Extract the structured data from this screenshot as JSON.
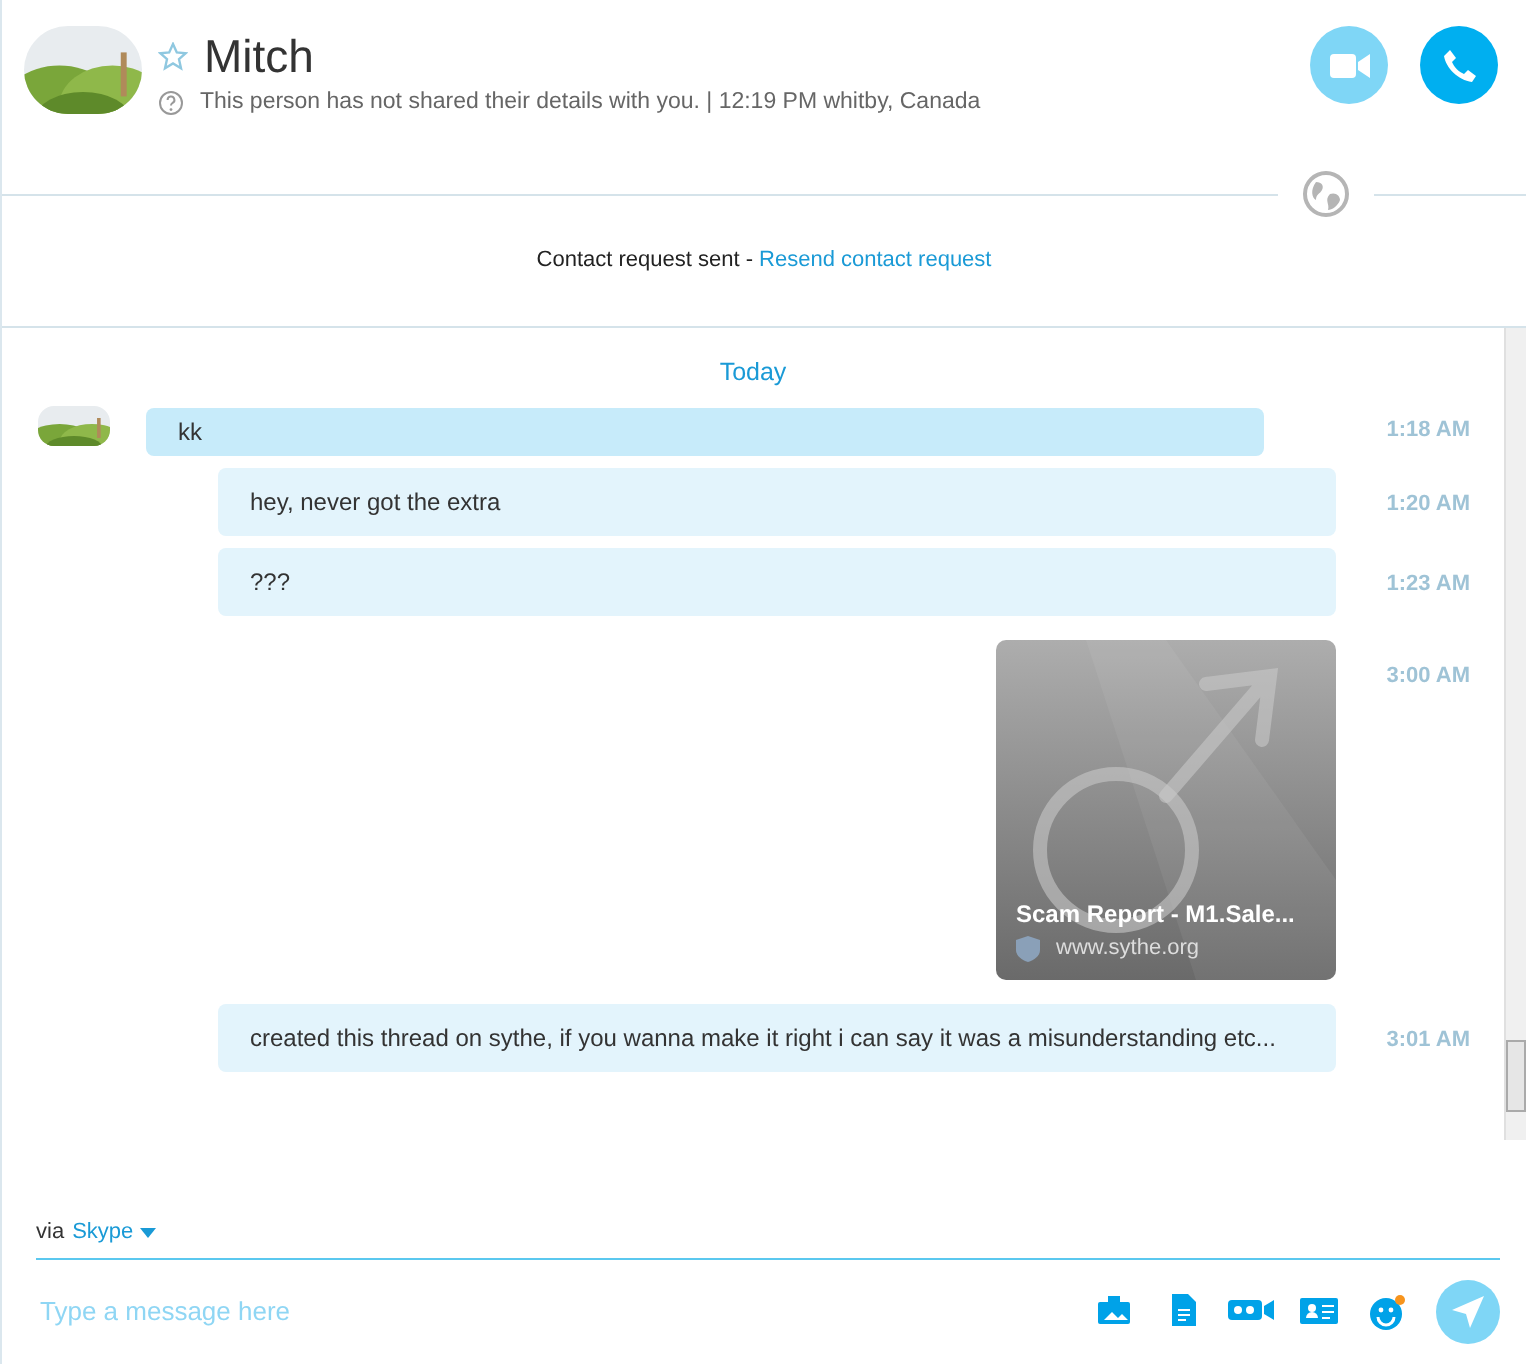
{
  "contact": {
    "name": "Mitch",
    "favorite": false,
    "status": "This person has not shared their details with you. | 12:19 PM whitby, Canada"
  },
  "contact_request": {
    "text": "Contact request sent -",
    "link": "Resend contact request"
  },
  "day_label": "Today",
  "messages": [
    {
      "kind": "incoming",
      "text": "kk",
      "time": "1:18 AM"
    },
    {
      "kind": "outgoing",
      "text": "hey, never got the extra",
      "time": "1:20 AM"
    },
    {
      "kind": "outgoing",
      "text": "???",
      "time": "1:23 AM"
    },
    {
      "kind": "link",
      "title": "Scam Report - M1.Sale...",
      "site": "www.sythe.org",
      "time": "3:00 AM"
    },
    {
      "kind": "outgoing",
      "text": "created this thread on sythe, if you wanna make it right i can say it was a misunderstanding etc...",
      "time": "3:01 AM"
    }
  ],
  "compose": {
    "via": "via",
    "service": "Skype",
    "placeholder": "Type a message here"
  }
}
